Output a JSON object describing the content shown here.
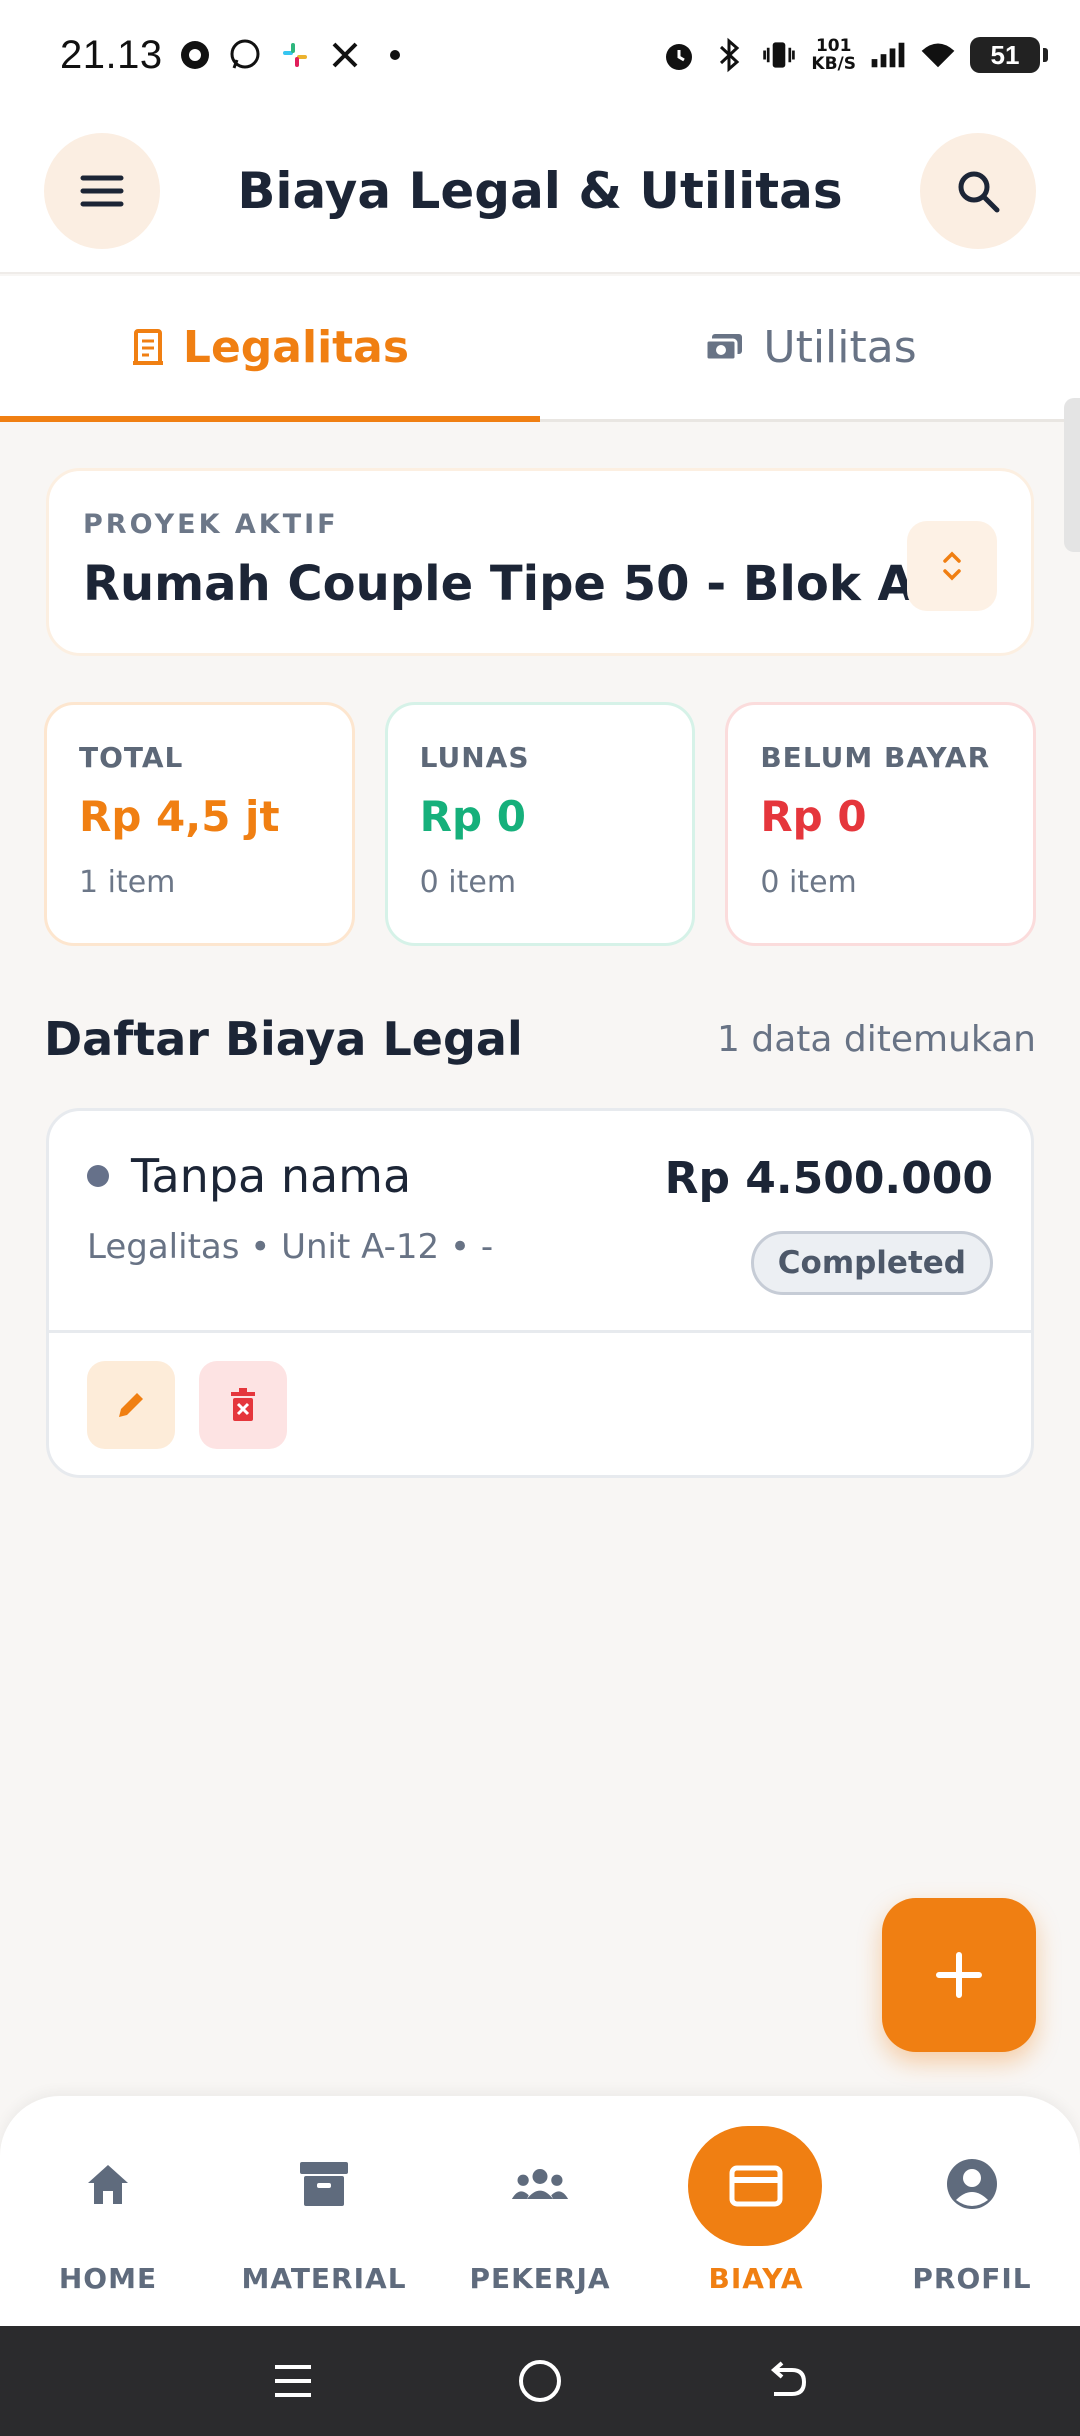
{
  "status_bar": {
    "time": "21.13",
    "net_rate_top": "101",
    "net_rate_bottom": "KB/S",
    "battery": "51"
  },
  "app_bar": {
    "title": "Biaya Legal & Utilitas",
    "menu_icon": "menu-icon",
    "search_icon": "search-icon"
  },
  "tabs": [
    {
      "label": "Legalitas",
      "icon": "receipt-icon",
      "active": true
    },
    {
      "label": "Utilitas",
      "icon": "money-icon",
      "active": false
    }
  ],
  "project": {
    "label": "PROYEK AKTIF",
    "name": "Rumah Couple Tipe 50 - Blok A"
  },
  "stats": {
    "total": {
      "label": "TOTAL",
      "value": "Rp 4,5 jt",
      "sub": "1 item"
    },
    "lunas": {
      "label": "LUNAS",
      "value": "Rp 0",
      "sub": "0 item"
    },
    "belum": {
      "label": "BELUM BAYAR",
      "value": "Rp 0",
      "sub": "0 item"
    }
  },
  "list": {
    "title": "Daftar Biaya Legal",
    "count": "1 data ditemukan",
    "items": [
      {
        "name": "Tanpa nama",
        "meta": "Legalitas • Unit A-12 • -",
        "amount": "Rp 4.500.000",
        "status": "Completed"
      }
    ]
  },
  "bottom_nav": [
    {
      "label": "HOME",
      "icon": "home-icon",
      "active": false
    },
    {
      "label": "MATERIAL",
      "icon": "archive-icon",
      "active": false
    },
    {
      "label": "PEKERJA",
      "icon": "users-icon",
      "active": false
    },
    {
      "label": "BIAYA",
      "icon": "credit-card-icon",
      "active": true
    },
    {
      "label": "PROFIL",
      "icon": "profile-icon",
      "active": false
    }
  ],
  "colors": {
    "accent": "#f07f12",
    "success": "#16b07b",
    "danger": "#e5363c",
    "text": "#1c2536",
    "muted": "#687385"
  }
}
